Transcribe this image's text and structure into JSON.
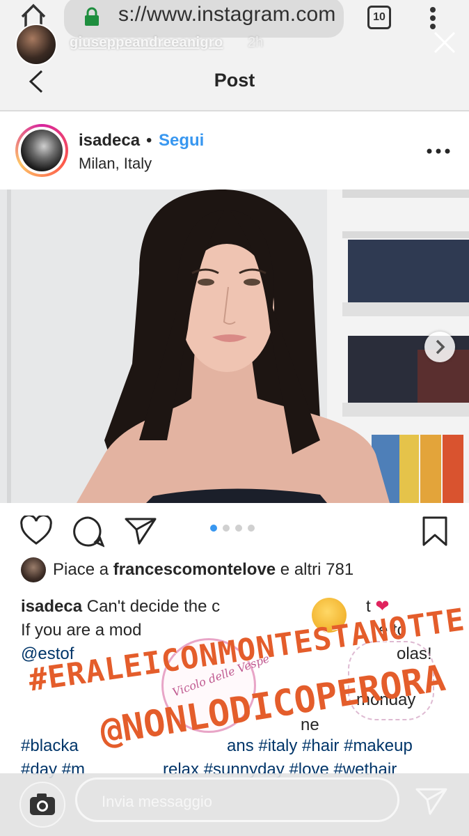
{
  "browser": {
    "url_prefix": "s://",
    "url_domain": "www.instagram.com",
    "tabs_count": "10"
  },
  "story": {
    "username": "giuseppeandreeanigro",
    "time": "2h"
  },
  "page": {
    "title": "Post"
  },
  "post": {
    "username": "isadeca",
    "separator": "•",
    "follow_label": "Segui",
    "location": "Milan, Italy",
    "carousel": {
      "count": 4,
      "active_index": 1
    },
    "likes": {
      "prefix": "Piace a ",
      "user": "francescomontelove",
      "suffix": " e altri 781"
    },
    "caption": {
      "line1_user": "isadeca",
      "line1_text": " Can't decide the c",
      "line1_tail": "t",
      "line2": "If you are a mod",
      "line2_tail": "e to",
      "line3_start": "@estof",
      "line3_end": "olas!",
      "line4_end": "monday",
      "line5_end": "ne",
      "line6": "#blacka",
      "line6_tags": "ans #italy #hair #makeup",
      "line7": "#day #m",
      "line7_tags": "relax #sunnyday #love #wethair"
    }
  },
  "overlay": {
    "hashtag_sticker": "#ERALEICONMONTESTANOTTE",
    "mention_sticker": "@NONLODICOPERORA",
    "circle_sticker": "Vicolo delle Vespe"
  },
  "reply": {
    "placeholder": "Invia messaggio"
  },
  "colors": {
    "follow_blue": "#3897f0",
    "sticker_orange": "#e45d2b",
    "heart_red": "#e0245e",
    "active_dot": "#3897f0"
  }
}
